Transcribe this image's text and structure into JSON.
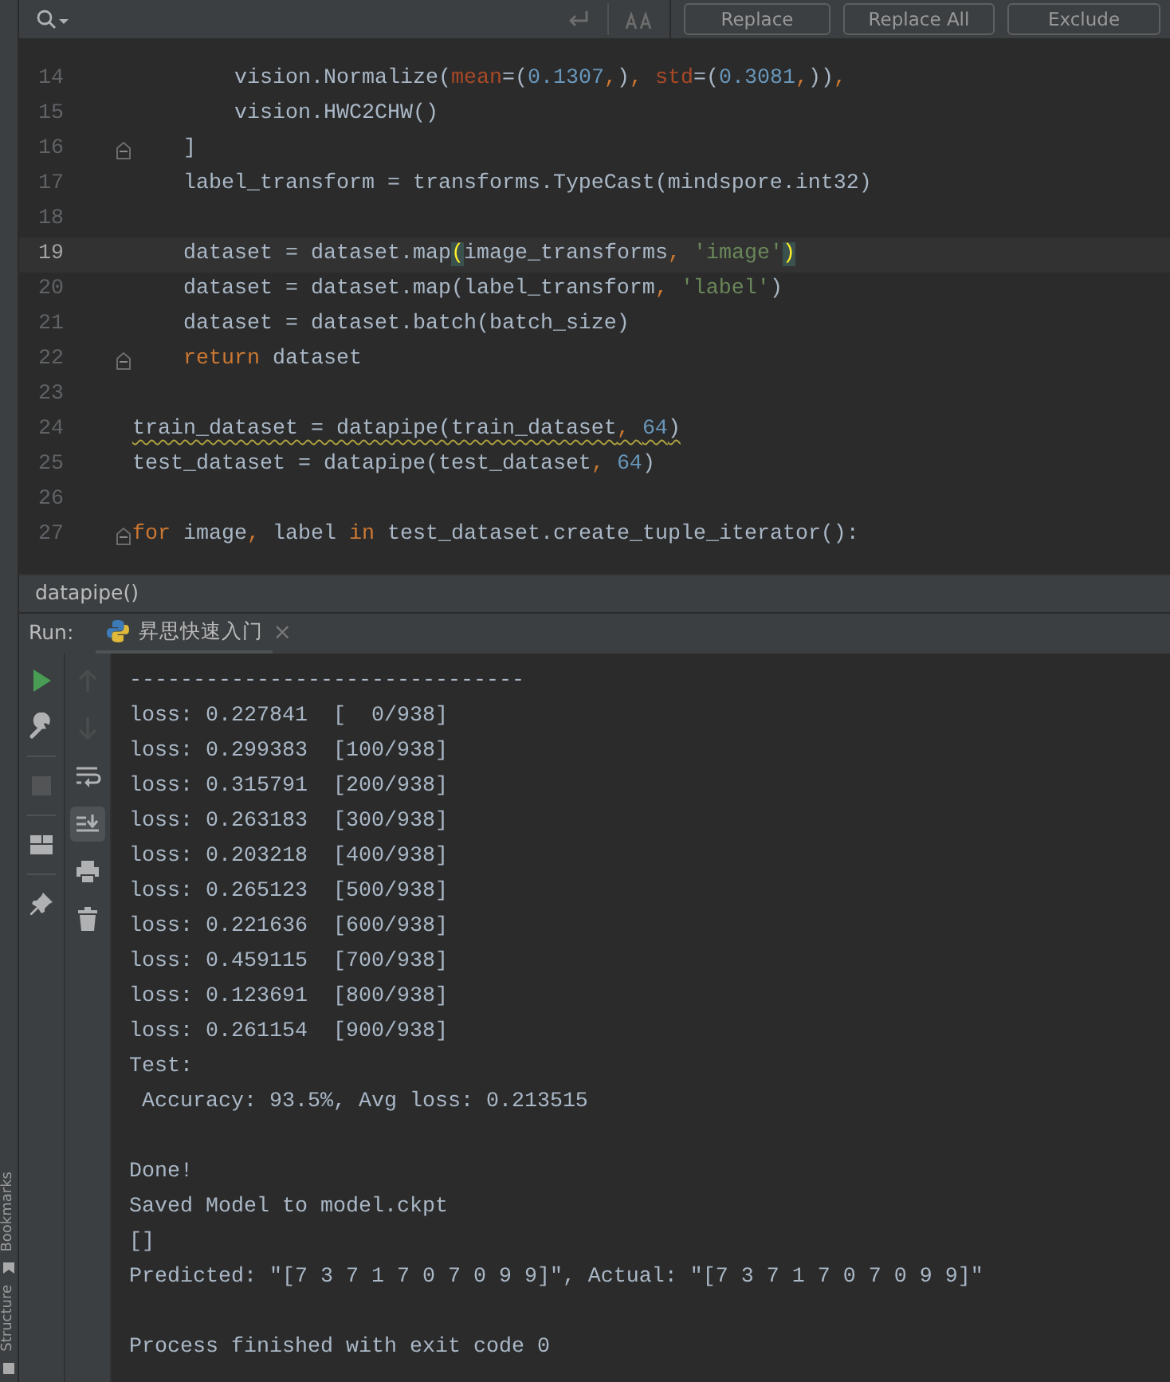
{
  "search_bar": {
    "buttons": [
      {
        "label": "Replace"
      },
      {
        "label": "Replace All"
      },
      {
        "label": "Exclude"
      }
    ]
  },
  "editor": {
    "lines": [
      {
        "number": "14",
        "current": false,
        "warning": false,
        "fold": false,
        "segments": [
          {
            "kind": "plain",
            "text": "        vision.Normalize("
          },
          {
            "kind": "param",
            "text": "mean"
          },
          {
            "kind": "plain",
            "text": "=("
          },
          {
            "kind": "num",
            "text": "0.1307"
          },
          {
            "kind": "kw",
            "text": ","
          },
          {
            "kind": "plain",
            "text": ")"
          },
          {
            "kind": "kw",
            "text": ", "
          },
          {
            "kind": "param",
            "text": "std"
          },
          {
            "kind": "plain",
            "text": "=("
          },
          {
            "kind": "num",
            "text": "0.3081"
          },
          {
            "kind": "kw",
            "text": ","
          },
          {
            "kind": "plain",
            "text": "))"
          },
          {
            "kind": "kw",
            "text": ","
          }
        ]
      },
      {
        "number": "15",
        "current": false,
        "warning": false,
        "fold": false,
        "segments": [
          {
            "kind": "plain",
            "text": "        vision.HWC2CHW()"
          }
        ]
      },
      {
        "number": "16",
        "current": false,
        "warning": false,
        "fold": true,
        "segments": [
          {
            "kind": "plain",
            "text": "    ]"
          }
        ]
      },
      {
        "number": "17",
        "current": false,
        "warning": false,
        "fold": false,
        "segments": [
          {
            "kind": "plain",
            "text": "    label_transform = transforms.TypeCast(mindspore.int32)"
          }
        ]
      },
      {
        "number": "18",
        "current": false,
        "warning": false,
        "fold": false
      },
      {
        "number": "19",
        "current": true,
        "warning": false,
        "fold": false,
        "segments": [
          {
            "kind": "plain",
            "text": "    dataset = dataset.map"
          },
          {
            "kind": "match",
            "text": "("
          },
          {
            "kind": "plain",
            "text": "image_transforms"
          },
          {
            "kind": "kw",
            "text": ", "
          },
          {
            "kind": "str",
            "text": "'image'"
          },
          {
            "kind": "match",
            "text": ")"
          }
        ]
      },
      {
        "number": "20",
        "current": false,
        "warning": false,
        "fold": false,
        "segments": [
          {
            "kind": "plain",
            "text": "    dataset = dataset.map(label_transform"
          },
          {
            "kind": "kw",
            "text": ", "
          },
          {
            "kind": "str",
            "text": "'label'"
          },
          {
            "kind": "plain",
            "text": ")"
          }
        ]
      },
      {
        "number": "21",
        "current": false,
        "warning": false,
        "fold": false,
        "segments": [
          {
            "kind": "plain",
            "text": "    dataset = dataset.batch(batch_size)"
          }
        ]
      },
      {
        "number": "22",
        "current": false,
        "warning": false,
        "fold": true,
        "segments": [
          {
            "kind": "kw",
            "text": "    return"
          },
          {
            "kind": "plain",
            "text": " dataset"
          }
        ]
      },
      {
        "number": "23",
        "current": false,
        "warning": false,
        "fold": false
      },
      {
        "number": "24",
        "current": false,
        "warning": true,
        "fold": false,
        "segments": [
          {
            "kind": "plain",
            "text": "train_dataset = datapipe(train_dataset"
          },
          {
            "kind": "kw",
            "text": ", "
          },
          {
            "kind": "num",
            "text": "64"
          },
          {
            "kind": "plain",
            "text": ")"
          }
        ]
      },
      {
        "number": "25",
        "current": false,
        "warning": false,
        "fold": false,
        "segments": [
          {
            "kind": "plain",
            "text": "test_dataset = datapipe(test_dataset"
          },
          {
            "kind": "kw",
            "text": ", "
          },
          {
            "kind": "num",
            "text": "64"
          },
          {
            "kind": "plain",
            "text": ")"
          }
        ]
      },
      {
        "number": "26",
        "current": false,
        "warning": false,
        "fold": false
      },
      {
        "number": "27",
        "current": false,
        "warning": false,
        "fold": true,
        "segments": [
          {
            "kind": "kw",
            "text": "for"
          },
          {
            "kind": "plain",
            "text": " image"
          },
          {
            "kind": "kw",
            "text": ", "
          },
          {
            "kind": "plain",
            "text": "label "
          },
          {
            "kind": "kw",
            "text": "in"
          },
          {
            "kind": "plain",
            "text": " test_dataset.create_tuple_iterator():"
          }
        ]
      }
    ]
  },
  "breadcrumb": "datapipe()",
  "run": {
    "label": "Run:",
    "tab": {
      "title": "昇思快速入门",
      "selected": true,
      "close": "×"
    }
  },
  "run_tools": {
    "left": [
      {
        "disabled": false
      },
      {
        "disabled": false
      },
      {
        "disabled": true
      },
      {
        "disabled": false
      },
      {
        "disabled": false
      }
    ],
    "right": [
      {
        "disabled": true,
        "on": false
      },
      {
        "disabled": true,
        "on": false
      },
      {
        "disabled": false,
        "on": false
      },
      {
        "disabled": false,
        "on": true
      },
      {
        "disabled": false,
        "on": false
      },
      {
        "disabled": false,
        "on": false
      }
    ]
  },
  "console": {
    "lines": [
      {
        "kind": "text",
        "text": "-------------------------------"
      },
      {
        "kind": "text",
        "text": "loss: 0.227841  [  0/938]"
      },
      {
        "kind": "text",
        "text": "loss: 0.299383  [100/938]"
      },
      {
        "kind": "text",
        "text": "loss: 0.315791  [200/938]"
      },
      {
        "kind": "text",
        "text": "loss: 0.263183  [300/938]"
      },
      {
        "kind": "text",
        "text": "loss: 0.203218  [400/938]"
      },
      {
        "kind": "text",
        "text": "loss: 0.265123  [500/938]"
      },
      {
        "kind": "text",
        "text": "loss: 0.221636  [600/938]"
      },
      {
        "kind": "text",
        "text": "loss: 0.459115  [700/938]"
      },
      {
        "kind": "text",
        "text": "loss: 0.123691  [800/938]"
      },
      {
        "kind": "text",
        "text": "loss: 0.261154  [900/938]"
      },
      {
        "kind": "text",
        "text": "Test:"
      },
      {
        "kind": "text",
        "text": " Accuracy: 93.5%, Avg loss: 0.213515"
      },
      {
        "kind": "blank"
      },
      {
        "kind": "text",
        "text": "Done!"
      },
      {
        "kind": "text",
        "text": "Saved Model to model.ckpt"
      },
      {
        "kind": "text",
        "text": "[]"
      },
      {
        "kind": "text",
        "text": "Predicted: \"[7 3 7 1 7 0 7 0 9 9]\", Actual: \"[7 3 7 1 7 0 7 0 9 9]\""
      },
      {
        "kind": "blank"
      },
      {
        "kind": "text",
        "text": "Process finished with exit code 0"
      }
    ]
  },
  "side_strip": [
    "Bookmarks",
    "Structure"
  ]
}
